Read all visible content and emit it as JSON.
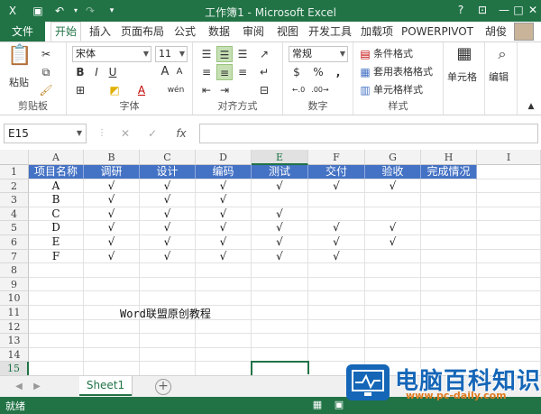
{
  "window": {
    "title": "工作簿1 - Microsoft Excel",
    "min": "—",
    "max": "□",
    "close": "✕",
    "help": "?"
  },
  "ribbon_tabs": {
    "file": "文件",
    "items": [
      "开始",
      "插入",
      "页面布局",
      "公式",
      "数据",
      "审阅",
      "视图",
      "开发工具",
      "加载项",
      "POWERPIVOT"
    ],
    "active": "开始",
    "user": "胡俊"
  },
  "ribbon": {
    "clipboard": {
      "paste": "粘贴",
      "label": "剪贴板"
    },
    "font": {
      "name": "宋体",
      "size": "11",
      "bold": "B",
      "italic": "I",
      "underline": "U",
      "label": "字体",
      "grow": "A",
      "shrink": "A",
      "color_a": "A",
      "wen": "wén"
    },
    "alignment": {
      "label": "对齐方式"
    },
    "number": {
      "format": "常规",
      "currency": "$",
      "percent": "%",
      "comma": ",",
      "label": "数字"
    },
    "styles": {
      "conditional": "条件格式",
      "table": "套用表格格式",
      "cell_style": "单元格样式",
      "label": "样式"
    },
    "cells": {
      "label": "单元格"
    },
    "edit": {
      "label": "编辑"
    }
  },
  "formula_bar": {
    "name_box": "E15",
    "cancel": "✕",
    "enter": "✓",
    "fx": "fx",
    "value": ""
  },
  "grid": {
    "columns": [
      "A",
      "B",
      "C",
      "D",
      "E",
      "F",
      "G",
      "H",
      "I"
    ],
    "selected_column": "E",
    "row_numbers": [
      "1",
      "2",
      "3",
      "4",
      "5",
      "6",
      "7",
      "8",
      "9",
      "10",
      "11",
      "12",
      "13",
      "14",
      "15"
    ],
    "selected_row": "15",
    "selected_cell": "E15",
    "rows": [
      [
        "项目名称",
        "调研",
        "设计",
        "编码",
        "测试",
        "交付",
        "验收",
        "完成情况"
      ],
      [
        "A",
        "√",
        "√",
        "√",
        "√",
        "√",
        "√",
        ""
      ],
      [
        "B",
        "√",
        "√",
        "√",
        "",
        "",
        "",
        ""
      ],
      [
        "C",
        "√",
        "√",
        "√",
        "√",
        "",
        "",
        ""
      ],
      [
        "D",
        "√",
        "√",
        "√",
        "√",
        "√",
        "√",
        ""
      ],
      [
        "E",
        "√",
        "√",
        "√",
        "√",
        "√",
        "√",
        ""
      ],
      [
        "F",
        "√",
        "√",
        "√",
        "√",
        "√",
        "",
        ""
      ]
    ],
    "annotation": "Word联盟原创教程",
    "header_fill": "#4472c4"
  },
  "sheets": {
    "active": "Sheet1",
    "add": "+"
  },
  "status": {
    "text": "就绪"
  },
  "watermark": {
    "name": "电脑百科知识",
    "domain": "www.pc-daily.com"
  },
  "colors": {
    "accent": "#217346",
    "header_blue": "#4472c4"
  }
}
